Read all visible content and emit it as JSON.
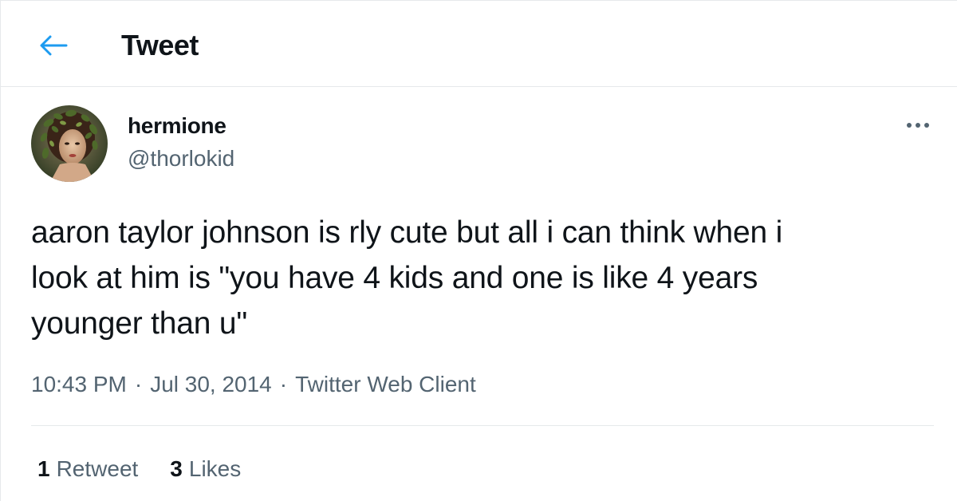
{
  "header": {
    "back_icon": "arrow-left-icon",
    "title": "Tweet"
  },
  "tweet": {
    "author": {
      "display_name": "hermione",
      "handle": "@thorlokid",
      "avatar": "profile-photo"
    },
    "more_icon": "more-horizontal-icon",
    "text": "aaron taylor johnson is rly cute but all i can think when i\nlook at him is \"you have 4 kids and one is like 4 years\nyounger than u\"",
    "time": "10:43 PM",
    "separator": "·",
    "date": "Jul 30, 2014",
    "client": "Twitter Web Client",
    "stats": {
      "retweets_count": "1",
      "retweets_label": "Retweet",
      "likes_count": "3",
      "likes_label": "Likes"
    }
  },
  "colors": {
    "accent": "#1d9bf0",
    "text_primary": "#0f1419",
    "text_secondary": "#536471",
    "border": "#e6e9eb"
  }
}
